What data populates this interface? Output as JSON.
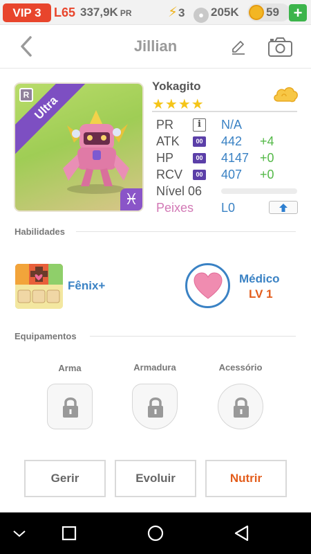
{
  "topbar": {
    "vip": "VIP 3",
    "level": "L65",
    "pr_value": "337,9K",
    "pr_unit": "PR",
    "energy": "3",
    "paw_value": "205K",
    "coins": "59",
    "plus": "+"
  },
  "header": {
    "title": "Jillian"
  },
  "monster": {
    "rarity_ribbon": "Ultra",
    "rarity_badge": "R",
    "zodiac": "♓",
    "name": "Yokagito",
    "stars": "★★★★",
    "star_count": 4
  },
  "stats": {
    "pr": {
      "label": "PR",
      "value": "N/A"
    },
    "atk": {
      "label": "ATK",
      "chip": "00",
      "value": "442",
      "bonus": "+4"
    },
    "hp": {
      "label": "HP",
      "chip": "00",
      "value": "4147",
      "bonus": "+0"
    },
    "rcv": {
      "label": "RCV",
      "chip": "00",
      "value": "407",
      "bonus": "+0"
    },
    "level": {
      "label": "Nível 06",
      "progress": 0
    },
    "peixes": {
      "label": "Peixes",
      "value": "L0"
    }
  },
  "abilities": {
    "title": "Habilidades",
    "skill_name": "Fênix+",
    "leader_name": "Médico",
    "leader_level": "LV 1"
  },
  "equipment": {
    "title": "Equipamentos",
    "slots": [
      "Arma",
      "Armadura",
      "Acessório"
    ]
  },
  "actions": {
    "manage": "Gerir",
    "evolve": "Evoluir",
    "feed": "Nutrir"
  },
  "colors": {
    "vip_red": "#e8452c",
    "accent_blue": "#3a82c4",
    "bonus_green": "#54b948",
    "feed_orange": "#e35d1c",
    "ultra_purple": "#7d4fc2"
  }
}
